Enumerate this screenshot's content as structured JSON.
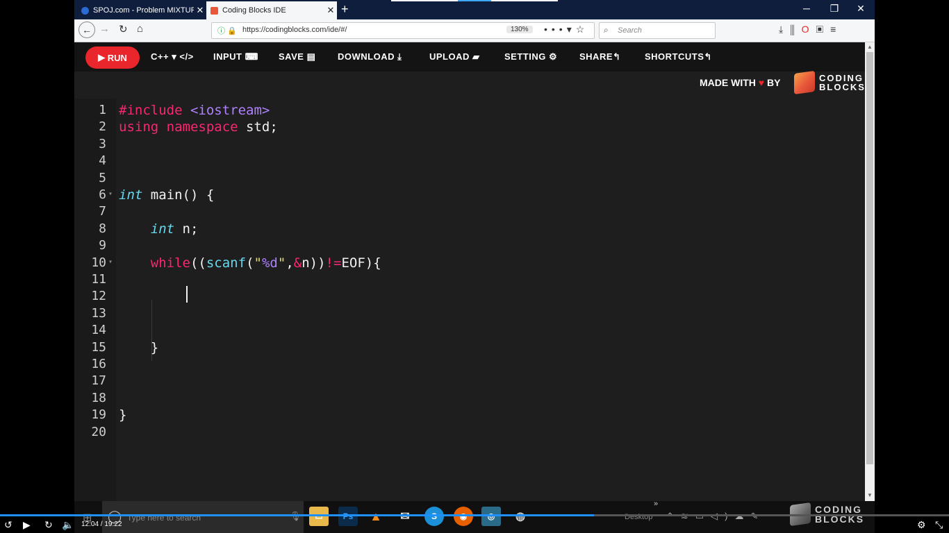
{
  "browser": {
    "tabs": [
      {
        "title": "SPOJ.com - Problem MIXTURES",
        "active": false
      },
      {
        "title": "Coding Blocks IDE",
        "active": true
      }
    ],
    "url": "https://codingblocks.com/ide/#/",
    "zoom": "130%",
    "search_placeholder": "Search"
  },
  "ide": {
    "run_label": "RUN",
    "toolbar": {
      "language": "C++",
      "input": "INPUT",
      "save": "SAVE",
      "download": "DOWNLOAD",
      "upload": "UPLOAD",
      "setting": "SETTING",
      "share": "SHARE",
      "shortcuts": "SHORTCUTS"
    },
    "made_with_prefix": "MADE WITH",
    "made_with_suffix": "BY",
    "brand_line1": "CODING",
    "brand_line2": "BLOCKS",
    "lines": [
      {
        "n": "1",
        "code": "#include <iostream>"
      },
      {
        "n": "2",
        "code": "using namespace std;"
      },
      {
        "n": "3",
        "code": ""
      },
      {
        "n": "4",
        "code": ""
      },
      {
        "n": "5",
        "code": ""
      },
      {
        "n": "6",
        "code": "int main() {"
      },
      {
        "n": "7",
        "code": ""
      },
      {
        "n": "8",
        "code": "    int n;"
      },
      {
        "n": "9",
        "code": ""
      },
      {
        "n": "10",
        "code": "    while((scanf(\"%d\",&n))!=EOF){"
      },
      {
        "n": "11",
        "code": ""
      },
      {
        "n": "12",
        "code": ""
      },
      {
        "n": "13",
        "code": ""
      },
      {
        "n": "14",
        "code": ""
      },
      {
        "n": "15",
        "code": "    }"
      },
      {
        "n": "16",
        "code": ""
      },
      {
        "n": "17",
        "code": ""
      },
      {
        "n": "18",
        "code": ""
      },
      {
        "n": "19",
        "code": "}"
      },
      {
        "n": "20",
        "code": ""
      }
    ]
  },
  "taskbar": {
    "search_placeholder": "Type here to search",
    "desktop_label": "Desktop",
    "watermark_line1": "CODING",
    "watermark_line2": "BLOCKS"
  },
  "video": {
    "current_time": "12:04",
    "duration": "19:22",
    "progress": 0.626
  },
  "colors": {
    "accent": "#e8262b",
    "editor_bg": "#1e1e1e",
    "keyword": "#f92672",
    "type": "#66d9ef",
    "string": "#e6db74",
    "progress": "#1e90ff"
  }
}
